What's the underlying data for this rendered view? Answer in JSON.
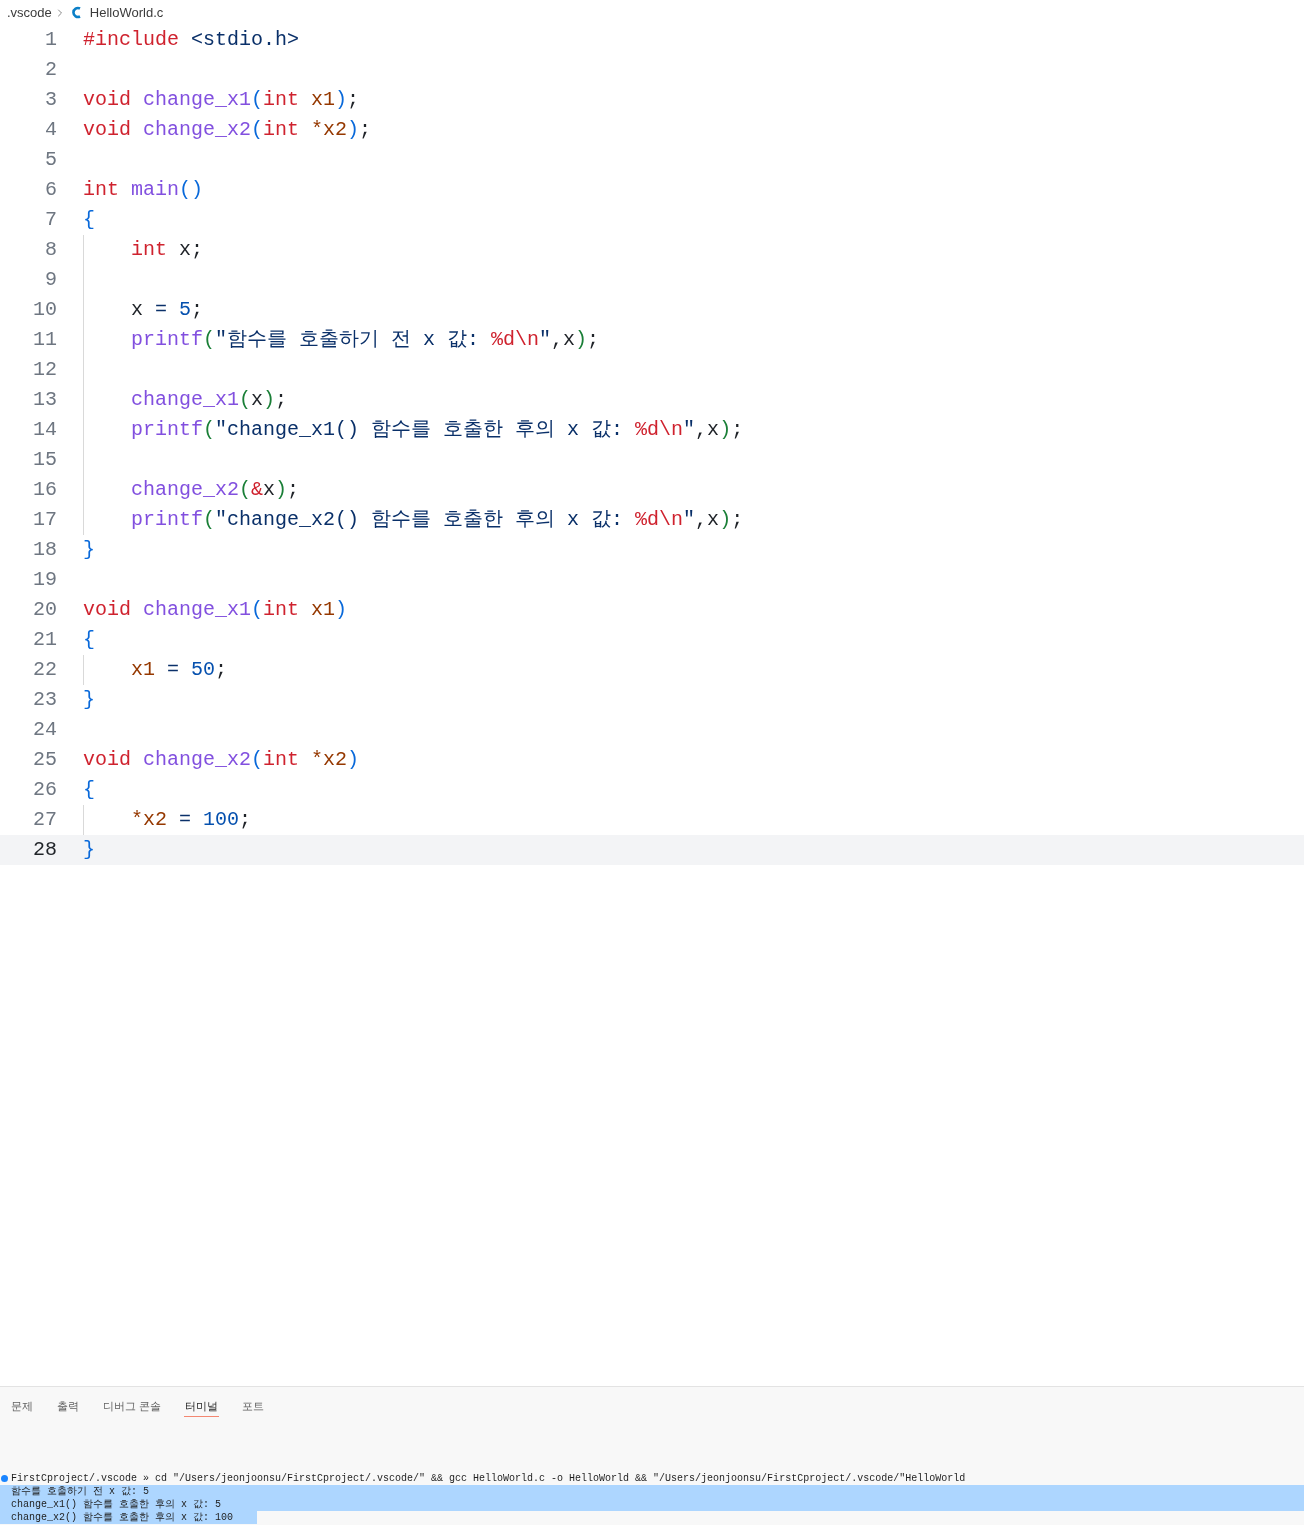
{
  "breadcrumb": [
    {
      "label": ".vscode",
      "kind": "folder"
    },
    {
      "label": "HelloWorld.c",
      "kind": "file"
    }
  ],
  "editor": {
    "lines": [
      {
        "number": "1",
        "current": false,
        "indented": false,
        "tokens": [
          {
            "text": "#include ",
            "kind": "kw"
          },
          {
            "text": "<stdio.h>",
            "kind": "str"
          }
        ]
      },
      {
        "number": "2",
        "current": false,
        "indented": false
      },
      {
        "number": "3",
        "current": false,
        "indented": false,
        "tokens": [
          {
            "text": "void ",
            "kind": "kw"
          },
          {
            "text": "change_x1",
            "kind": "fn"
          },
          {
            "text": "(",
            "kind": "b1"
          },
          {
            "text": "int ",
            "kind": "kw"
          },
          {
            "text": "x1",
            "kind": "param"
          },
          {
            "text": ")",
            "kind": "b1"
          },
          {
            "text": ";",
            "kind": "txt"
          }
        ]
      },
      {
        "number": "4",
        "current": false,
        "indented": false,
        "tokens": [
          {
            "text": "void ",
            "kind": "kw"
          },
          {
            "text": "change_x2",
            "kind": "fn"
          },
          {
            "text": "(",
            "kind": "b1"
          },
          {
            "text": "int ",
            "kind": "kw"
          },
          {
            "text": "*x2",
            "kind": "param"
          },
          {
            "text": ")",
            "kind": "b1"
          },
          {
            "text": ";",
            "kind": "txt"
          }
        ]
      },
      {
        "number": "5",
        "current": false,
        "indented": false
      },
      {
        "number": "6",
        "current": false,
        "indented": false,
        "tokens": [
          {
            "text": "int ",
            "kind": "kw"
          },
          {
            "text": "main",
            "kind": "fn"
          },
          {
            "text": "()",
            "kind": "b1"
          }
        ]
      },
      {
        "number": "7",
        "current": false,
        "indented": false,
        "tokens": [
          {
            "text": "{",
            "kind": "b1"
          }
        ]
      },
      {
        "number": "8",
        "current": false,
        "indented": true,
        "tokens": [
          {
            "text": "int",
            "kind": "kw"
          },
          {
            "text": " x;",
            "kind": "txt"
          }
        ]
      },
      {
        "number": "9",
        "current": false,
        "indented": true
      },
      {
        "number": "10",
        "current": false,
        "indented": true,
        "tokens": [
          {
            "text": "x ",
            "kind": "txt"
          },
          {
            "text": "= ",
            "kind": "op"
          },
          {
            "text": "5",
            "kind": "num"
          },
          {
            "text": ";",
            "kind": "txt"
          }
        ]
      },
      {
        "number": "11",
        "current": false,
        "indented": true,
        "tokens": [
          {
            "text": "printf",
            "kind": "fn"
          },
          {
            "text": "(",
            "kind": "b2"
          },
          {
            "text": "\"함수를 호출하기 전 x 값: ",
            "kind": "str"
          },
          {
            "text": "%d\\n",
            "kind": "esc"
          },
          {
            "text": "\"",
            "kind": "str"
          },
          {
            "text": ",x",
            "kind": "txt"
          },
          {
            "text": ")",
            "kind": "b2"
          },
          {
            "text": ";",
            "kind": "txt"
          }
        ]
      },
      {
        "number": "12",
        "current": false,
        "indented": true
      },
      {
        "number": "13",
        "current": false,
        "indented": true,
        "tokens": [
          {
            "text": "change_x1",
            "kind": "fn"
          },
          {
            "text": "(",
            "kind": "b2"
          },
          {
            "text": "x",
            "kind": "txt"
          },
          {
            "text": ")",
            "kind": "b2"
          },
          {
            "text": ";",
            "kind": "txt"
          }
        ]
      },
      {
        "number": "14",
        "current": false,
        "indented": true,
        "tokens": [
          {
            "text": "printf",
            "kind": "fn"
          },
          {
            "text": "(",
            "kind": "b2"
          },
          {
            "text": "\"change_x1() 함수를 호출한 후의 x 값: ",
            "kind": "str"
          },
          {
            "text": "%d\\n",
            "kind": "esc"
          },
          {
            "text": "\"",
            "kind": "str"
          },
          {
            "text": ",x",
            "kind": "txt"
          },
          {
            "text": ")",
            "kind": "b2"
          },
          {
            "text": ";",
            "kind": "txt"
          }
        ]
      },
      {
        "number": "15",
        "current": false,
        "indented": true
      },
      {
        "number": "16",
        "current": false,
        "indented": true,
        "tokens": [
          {
            "text": "change_x2",
            "kind": "fn"
          },
          {
            "text": "(",
            "kind": "b2"
          },
          {
            "text": "&",
            "kind": "kw"
          },
          {
            "text": "x",
            "kind": "txt"
          },
          {
            "text": ")",
            "kind": "b2"
          },
          {
            "text": ";",
            "kind": "txt"
          }
        ]
      },
      {
        "number": "17",
        "current": false,
        "indented": true,
        "tokens": [
          {
            "text": "printf",
            "kind": "fn"
          },
          {
            "text": "(",
            "kind": "b2"
          },
          {
            "text": "\"change_x2() 함수를 호출한 후의 x 값: ",
            "kind": "str"
          },
          {
            "text": "%d\\n",
            "kind": "esc"
          },
          {
            "text": "\"",
            "kind": "str"
          },
          {
            "text": ",x",
            "kind": "txt"
          },
          {
            "text": ")",
            "kind": "b2"
          },
          {
            "text": ";",
            "kind": "txt"
          }
        ]
      },
      {
        "number": "18",
        "current": false,
        "indented": false,
        "tokens": [
          {
            "text": "}",
            "kind": "b1"
          }
        ]
      },
      {
        "number": "19",
        "current": false,
        "indented": false
      },
      {
        "number": "20",
        "current": false,
        "indented": false,
        "tokens": [
          {
            "text": "void ",
            "kind": "kw"
          },
          {
            "text": "change_x1",
            "kind": "fn"
          },
          {
            "text": "(",
            "kind": "b1"
          },
          {
            "text": "int ",
            "kind": "kw"
          },
          {
            "text": "x1",
            "kind": "param"
          },
          {
            "text": ")",
            "kind": "b1"
          }
        ]
      },
      {
        "number": "21",
        "current": false,
        "indented": false,
        "tokens": [
          {
            "text": "{",
            "kind": "b1"
          }
        ]
      },
      {
        "number": "22",
        "current": false,
        "indented": true,
        "tokens": [
          {
            "text": "x1 ",
            "kind": "param"
          },
          {
            "text": "= ",
            "kind": "op"
          },
          {
            "text": "50",
            "kind": "num"
          },
          {
            "text": ";",
            "kind": "txt"
          }
        ]
      },
      {
        "number": "23",
        "current": false,
        "indented": false,
        "tokens": [
          {
            "text": "}",
            "kind": "b1"
          }
        ]
      },
      {
        "number": "24",
        "current": false,
        "indented": false
      },
      {
        "number": "25",
        "current": false,
        "indented": false,
        "tokens": [
          {
            "text": "void ",
            "kind": "kw"
          },
          {
            "text": "change_x2",
            "kind": "fn"
          },
          {
            "text": "(",
            "kind": "b1"
          },
          {
            "text": "int ",
            "kind": "kw"
          },
          {
            "text": "*x2",
            "kind": "param"
          },
          {
            "text": ")",
            "kind": "b1"
          }
        ]
      },
      {
        "number": "26",
        "current": false,
        "indented": false,
        "tokens": [
          {
            "text": "{",
            "kind": "b1"
          }
        ]
      },
      {
        "number": "27",
        "current": false,
        "indented": true,
        "tokens": [
          {
            "text": "*x2 ",
            "kind": "param"
          },
          {
            "text": "= ",
            "kind": "op"
          },
          {
            "text": "100",
            "kind": "num"
          },
          {
            "text": ";",
            "kind": "txt"
          }
        ]
      },
      {
        "number": "28",
        "current": true,
        "indented": false,
        "tokens": [
          {
            "text": "}",
            "kind": "b1"
          }
        ]
      }
    ]
  },
  "panel": {
    "tabs": [
      {
        "label": "문제",
        "selected": false
      },
      {
        "label": "출력",
        "selected": false
      },
      {
        "label": "디버그 콘솔",
        "selected": false
      },
      {
        "label": "터미널",
        "selected": true
      },
      {
        "label": "포트",
        "selected": false
      }
    ],
    "terminal": {
      "prompt": "FirstCproject/.vscode » cd \"/Users/jeonjoonsu/FirstCproject/.vscode/\" && gcc HelloWorld.c -o HelloWorld && \"/Users/jeonjoonsu/FirstCproject/.vscode/\"HelloWorld",
      "lines": [
        {
          "text": "함수를 호출하기 전 x 값: 5",
          "selected": true
        },
        {
          "text": "change_x1() 함수를 호출한 후의 x 값: 5",
          "selected": true
        },
        {
          "text": "change_x2() 함수를 호출한 후의 x 값: 100",
          "selected": true
        }
      ]
    }
  }
}
